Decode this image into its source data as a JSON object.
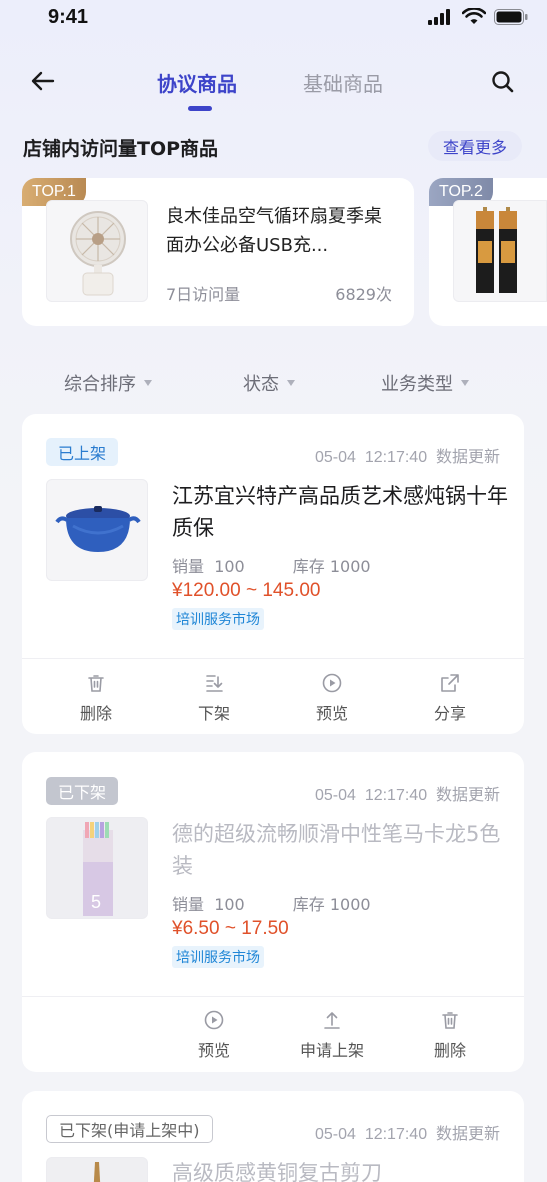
{
  "status_bar": {
    "time": "9:41"
  },
  "header": {
    "tabs": [
      {
        "label": "协议商品",
        "active": true
      },
      {
        "label": "基础商品",
        "active": false
      }
    ]
  },
  "top_section": {
    "title": "店铺内访问量TOP商品",
    "see_more": "查看更多",
    "items": [
      {
        "rank": "TOP.1",
        "name": "良木佳品空气循环扇夏季桌面办公必备USB充...",
        "visits_label": "7日访问量",
        "visits_value": "6829次",
        "badge_color": "#c89a5f"
      },
      {
        "rank": "TOP.2",
        "badge_color": "#8a96b4"
      }
    ]
  },
  "filters": [
    {
      "label": "综合排序"
    },
    {
      "label": "状态"
    },
    {
      "label": "业务类型"
    }
  ],
  "products": [
    {
      "status": "已上架",
      "date": "05-04",
      "time": "12:17:40",
      "update_label": "数据更新",
      "title": "江苏宜兴特产高品质艺术感炖锅十年质保",
      "sales_label": "销量",
      "sales": "100",
      "stock_label": "库存",
      "stock": "1000",
      "price": "¥120.00 ~ 145.00",
      "tag": "培训服务市场",
      "actions": [
        "删除",
        "下架",
        "预览",
        "分享"
      ]
    },
    {
      "status": "已下架",
      "date": "05-04",
      "time": "12:17:40",
      "update_label": "数据更新",
      "title": "德的超级流畅顺滑中性笔马卡龙5色装",
      "sales_label": "销量",
      "sales": "100",
      "stock_label": "库存",
      "stock": "1000",
      "price": "¥6.50 ~ 17.50",
      "tag": "培训服务市场",
      "actions": [
        "预览",
        "申请上架",
        "删除"
      ]
    },
    {
      "status": "已下架(申请上架中)",
      "date": "05-04",
      "time": "12:17:40",
      "update_label": "数据更新",
      "title": "高级质感黄铜复古剪刀"
    }
  ],
  "colors": {
    "accent": "#3d44c9",
    "price": "#e0512a",
    "tag": "#1f86d6",
    "status_on_bg": "#e5f1fc",
    "status_off_bg": "#c3c6cf"
  }
}
